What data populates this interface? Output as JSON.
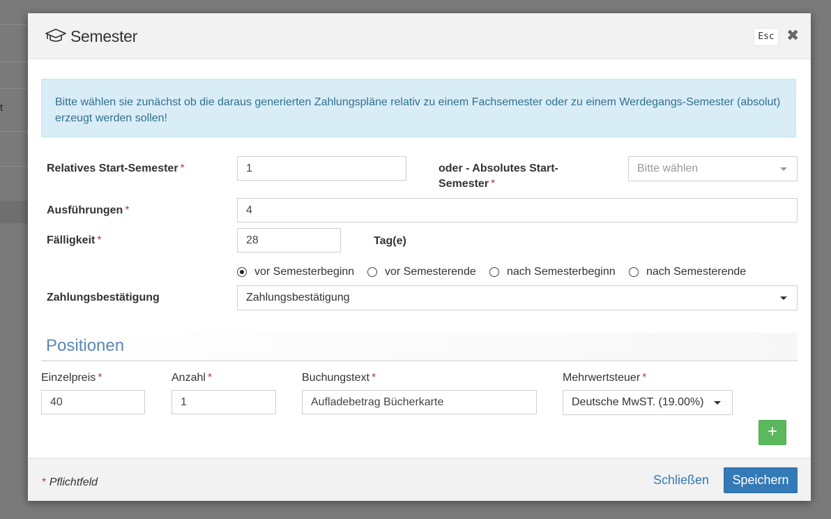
{
  "background": {
    "partial_text": "t"
  },
  "modal": {
    "title": "Semester",
    "esc_label": "Esc",
    "close_glyph": "✖",
    "info_text": "Bitte wählen sie zunächst ob die daraus generierten Zahlungspläne relativ zu einem Fachsemester oder zu einem Werdegangs-Semester (absolut) erzeugt werden sollen!"
  },
  "form": {
    "relative_start": {
      "label": "Relatives Start-Semester",
      "value": "1"
    },
    "absolute_start": {
      "label_line1": "oder - Absolutes Start-",
      "label_line2": "Semester",
      "placeholder": "Bitte wählen"
    },
    "executions": {
      "label": "Ausführungen",
      "value": "4"
    },
    "due": {
      "label": "Fälligkeit",
      "value": "28",
      "unit": "Tag(e)"
    },
    "due_options": [
      {
        "label": "vor Semesterbeginn",
        "checked": true
      },
      {
        "label": "vor Semesterende",
        "checked": false
      },
      {
        "label": "nach Semesterbeginn",
        "checked": false
      },
      {
        "label": "nach Semesterende",
        "checked": false
      }
    ],
    "payment_confirmation": {
      "label": "Zahlungsbestätigung",
      "value": "Zahlungsbestätigung"
    },
    "required_marker": "*"
  },
  "positions": {
    "title": "Positionen",
    "columns": {
      "unit_price": "Einzelpreis",
      "quantity": "Anzahl",
      "booking_text": "Buchungstext",
      "vat": "Mehrwertsteuer"
    },
    "row": {
      "unit_price": "40",
      "quantity": "1",
      "booking_text": "Aufladebetrag Bücherkarte",
      "vat": "Deutsche MwST. (19.00%)"
    },
    "add_glyph": "+"
  },
  "footer": {
    "required_note": "Pflichtfeld",
    "close_label": "Schließen",
    "save_label": "Speichern"
  },
  "colors": {
    "primary": "#337ab7",
    "success": "#5cb85c",
    "info_bg": "#d9edf7",
    "info_text": "#31708f",
    "required": "#a94442",
    "section_title": "#5b87b3"
  }
}
